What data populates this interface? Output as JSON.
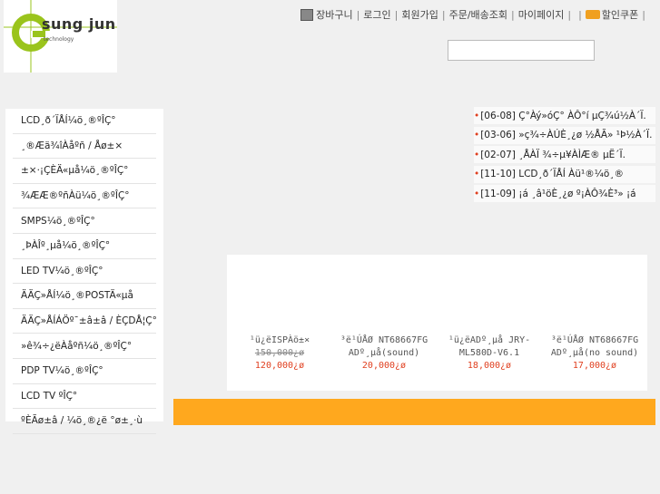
{
  "logo": {
    "title": "sung jun",
    "subtitle": "technology",
    "letter": "G"
  },
  "topnav": [
    {
      "label": "장바구니",
      "icon": "cart-icon"
    },
    {
      "label": "로그인"
    },
    {
      "label": "회원가입"
    },
    {
      "label": "주문/배송조회"
    },
    {
      "label": "마이페이지"
    },
    {
      "label": "할인쿠폰",
      "icon": "coupon-icon"
    }
  ],
  "search": {
    "placeholder": ""
  },
  "sidebar": {
    "items": [
      {
        "label": "LCD¸ð´ÏÅÍ¼ö¸®ºÎÇ°"
      },
      {
        "label": "¸®Æä¾îÀåºñ / Åø±×"
      },
      {
        "label": "±×·¡ÇÈÄ«µå¼ö¸®ºÎÇ°"
      },
      {
        "label": "¾ÆÆ®ºñÀü¼ö¸®ºÎÇ°"
      },
      {
        "label": "SMPS¼ö¸®ºÎÇ°"
      },
      {
        "label": "¸ÞÀÎº¸µå¼ö¸®ºÎÇ°"
      },
      {
        "label": "LED TV¼ö¸®ºÎÇ°"
      },
      {
        "label": "ÄÄÇ»ÅÍ¼ö¸®POSTÄ«µå"
      },
      {
        "label": "ÄÄÇ»ÅÍÁÖº¯±â±â / ÈÇDÅ¦Ç°"
      },
      {
        "label": "»ê¾÷¿ëÀåºñ¼ö¸®ºÎÇ°"
      },
      {
        "label": "PDP TV¼ö¸®ºÎÇ°"
      },
      {
        "label": "LCD TV ºÎÇ°"
      },
      {
        "label": "ºÈÃø±â / ¼ö¸®¿ë °ø±¸·ù"
      }
    ]
  },
  "news": [
    {
      "label": "[06-08] Ç°Àý»óÇ° ÀÔ°í µÇ¾ú½À´Ï."
    },
    {
      "label": "[03-06] »ç¾÷ÀÚÈ¸¿ø ½ÅÃ» ¹Þ½À´Ï."
    },
    {
      "label": "[02-07] ¸ÅÀÏ ¾÷µ¥ÀÌÆ® µË´Ï."
    },
    {
      "label": "[11-10] LCD¸ð´ÏÅÍ Àü¹®¼ö¸®"
    },
    {
      "label": "[11-09] ¡á ¸â¹öÈ¸¿ø º¡ÀÔ¾È³» ¡á"
    }
  ],
  "products": [
    {
      "name": "¹ü¿ëISPÀö±×",
      "old_price": "150,000¿ø",
      "price": "120,000¿ø"
    },
    {
      "name": "³ë¹ÚÅØ NT68667FG ADº¸µå(sound)",
      "old_price": "",
      "price": "20,000¿ø"
    },
    {
      "name": "¹ü¿ëADº¸µå JRY-ML580D-V6.1",
      "old_price": "",
      "price": "18,000¿ø"
    },
    {
      "name": "³ë¹ÚÅØ NT68667FG ADº¸µå(no sound)",
      "old_price": "",
      "price": "17,000¿ø"
    }
  ],
  "colors": {
    "accent": "#ffa81e",
    "price": "#e04020",
    "logo_green": "#9ac41c"
  }
}
